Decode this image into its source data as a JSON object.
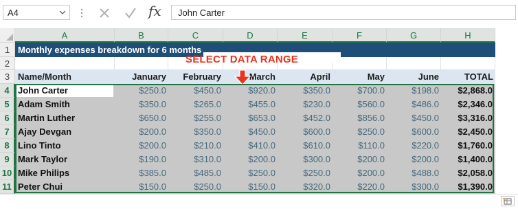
{
  "formula_bar": {
    "name_box": "A4",
    "cancel_icon": "x-icon",
    "enter_icon": "check-icon",
    "fx_label": "fx",
    "formula": "John Carter"
  },
  "columns": [
    "A",
    "B",
    "C",
    "D",
    "E",
    "F",
    "G",
    "H"
  ],
  "selected_columns": [
    "A",
    "B",
    "C",
    "D",
    "E",
    "F",
    "G",
    "H"
  ],
  "rows": [
    "1",
    "2",
    "3",
    "4",
    "5",
    "6",
    "7",
    "8",
    "9",
    "10",
    "11"
  ],
  "selected_rows": [
    "4",
    "5",
    "6",
    "7",
    "8",
    "9",
    "10",
    "11"
  ],
  "title": "Monthly expenses breakdown for 6 months",
  "annotation": "SELECT DATA RANGE",
  "header": {
    "name": "Name/Month",
    "months": [
      "January",
      "February",
      "March",
      "April",
      "May",
      "June"
    ],
    "total": "TOTAL"
  },
  "data": [
    {
      "name": "John Carter",
      "values": [
        "$250.0",
        "$450.0",
        "$920.0",
        "$350.0",
        "$700.0",
        "$198.0"
      ],
      "total": "$2,868.0"
    },
    {
      "name": "Adam Smith",
      "values": [
        "$350.0",
        "$265.0",
        "$455.0",
        "$230.0",
        "$560.0",
        "$486.0"
      ],
      "total": "$2,346.0"
    },
    {
      "name": "Martin Luther",
      "values": [
        "$650.0",
        "$255.0",
        "$653.0",
        "$452.0",
        "$856.0",
        "$450.0"
      ],
      "total": "$3,316.0"
    },
    {
      "name": "Ajay Devgan",
      "values": [
        "$200.0",
        "$350.0",
        "$450.0",
        "$600.0",
        "$250.0",
        "$600.0"
      ],
      "total": "$2,450.0"
    },
    {
      "name": "Lino Tinto",
      "values": [
        "$200.0",
        "$210.0",
        "$410.0",
        "$610.0",
        "$110.0",
        "$220.0"
      ],
      "total": "$1,760.0"
    },
    {
      "name": "Mark Taylor",
      "values": [
        "$190.0",
        "$310.0",
        "$200.0",
        "$300.0",
        "$200.0",
        "$200.0"
      ],
      "total": "$1,400.0"
    },
    {
      "name": "Mike Philips",
      "values": [
        "$385.0",
        "$485.0",
        "$250.0",
        "$250.0",
        "$200.0",
        "$488.0"
      ],
      "total": "$2,058.0"
    },
    {
      "name": "Peter Chui",
      "values": [
        "$150.0",
        "$250.0",
        "$150.0",
        "$320.0",
        "$220.0",
        "$300.0"
      ],
      "total": "$1,390.0"
    }
  ],
  "colors": {
    "title_band": "#1f4e79",
    "header_band": "#dce6f1",
    "selection_fill": "#c8c8c8",
    "selection_border": "#217346",
    "annotation_text": "#e8331f",
    "value_text": "#46697d"
  },
  "icons": {
    "quick_analysis": "quick-analysis-icon",
    "pointer": "down-arrow-icon"
  }
}
